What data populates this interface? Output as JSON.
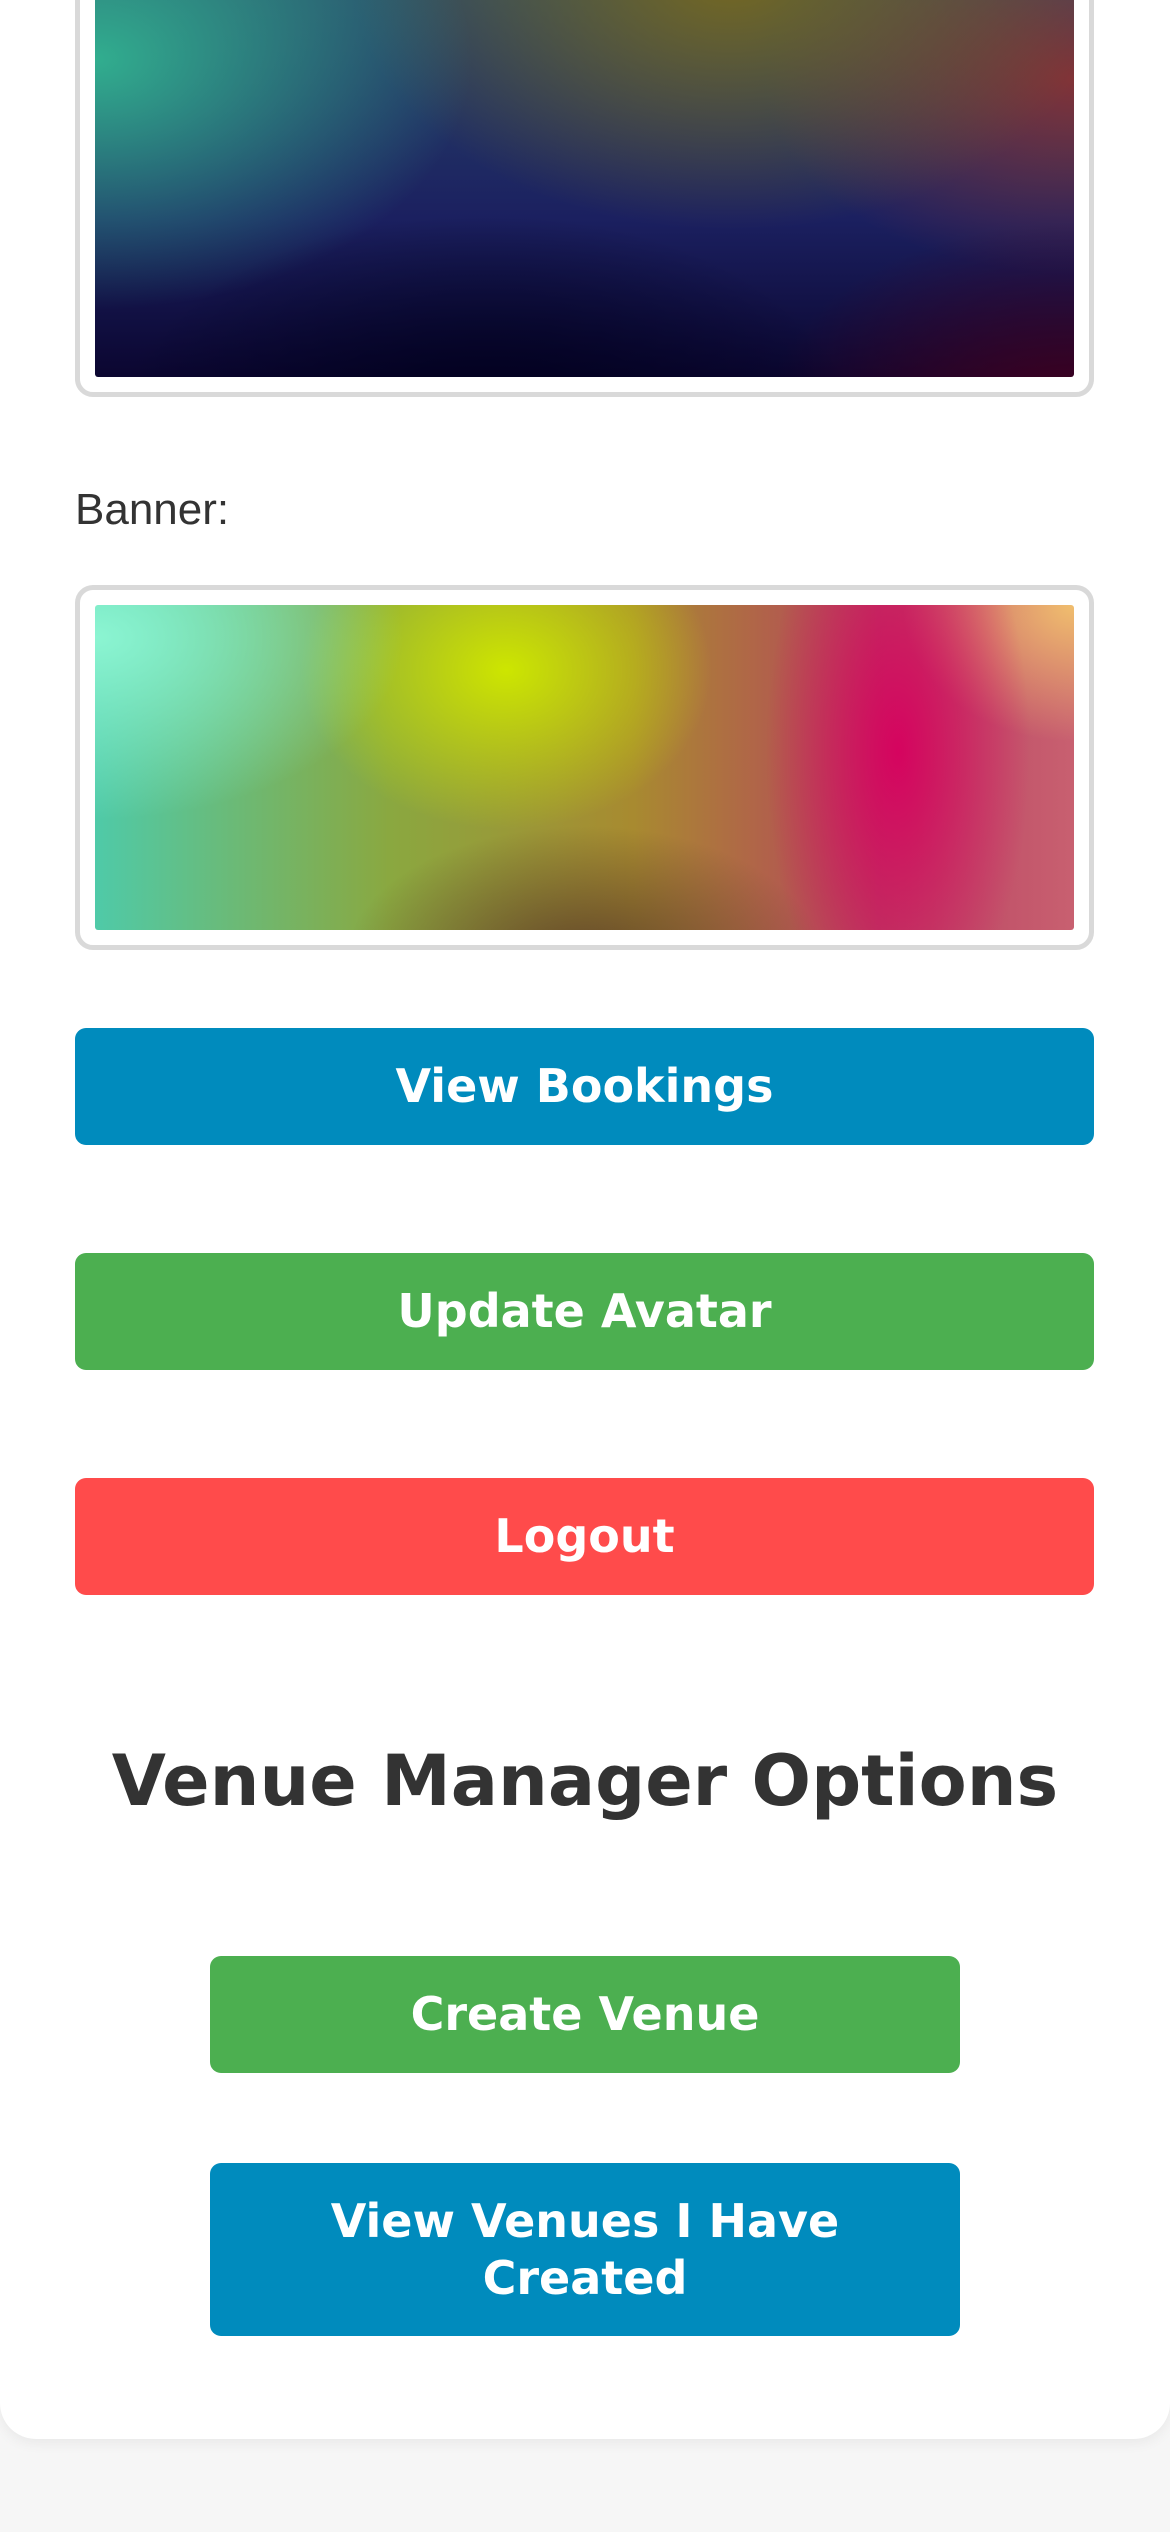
{
  "profile": {
    "banner_label": "Banner:"
  },
  "actions": {
    "view_bookings": "View Bookings",
    "update_avatar": "Update Avatar",
    "logout": "Logout"
  },
  "venue_manager": {
    "heading": "Venue Manager Options",
    "create_venue": "Create Venue",
    "view_venues": "View Venues I Have Created"
  },
  "colors": {
    "primary_blue": "#008bbd",
    "success_green": "#4caf50",
    "danger_red": "#ff4b4b",
    "text_dark": "#333333",
    "page_background": "#f6f6f6"
  },
  "icons": []
}
